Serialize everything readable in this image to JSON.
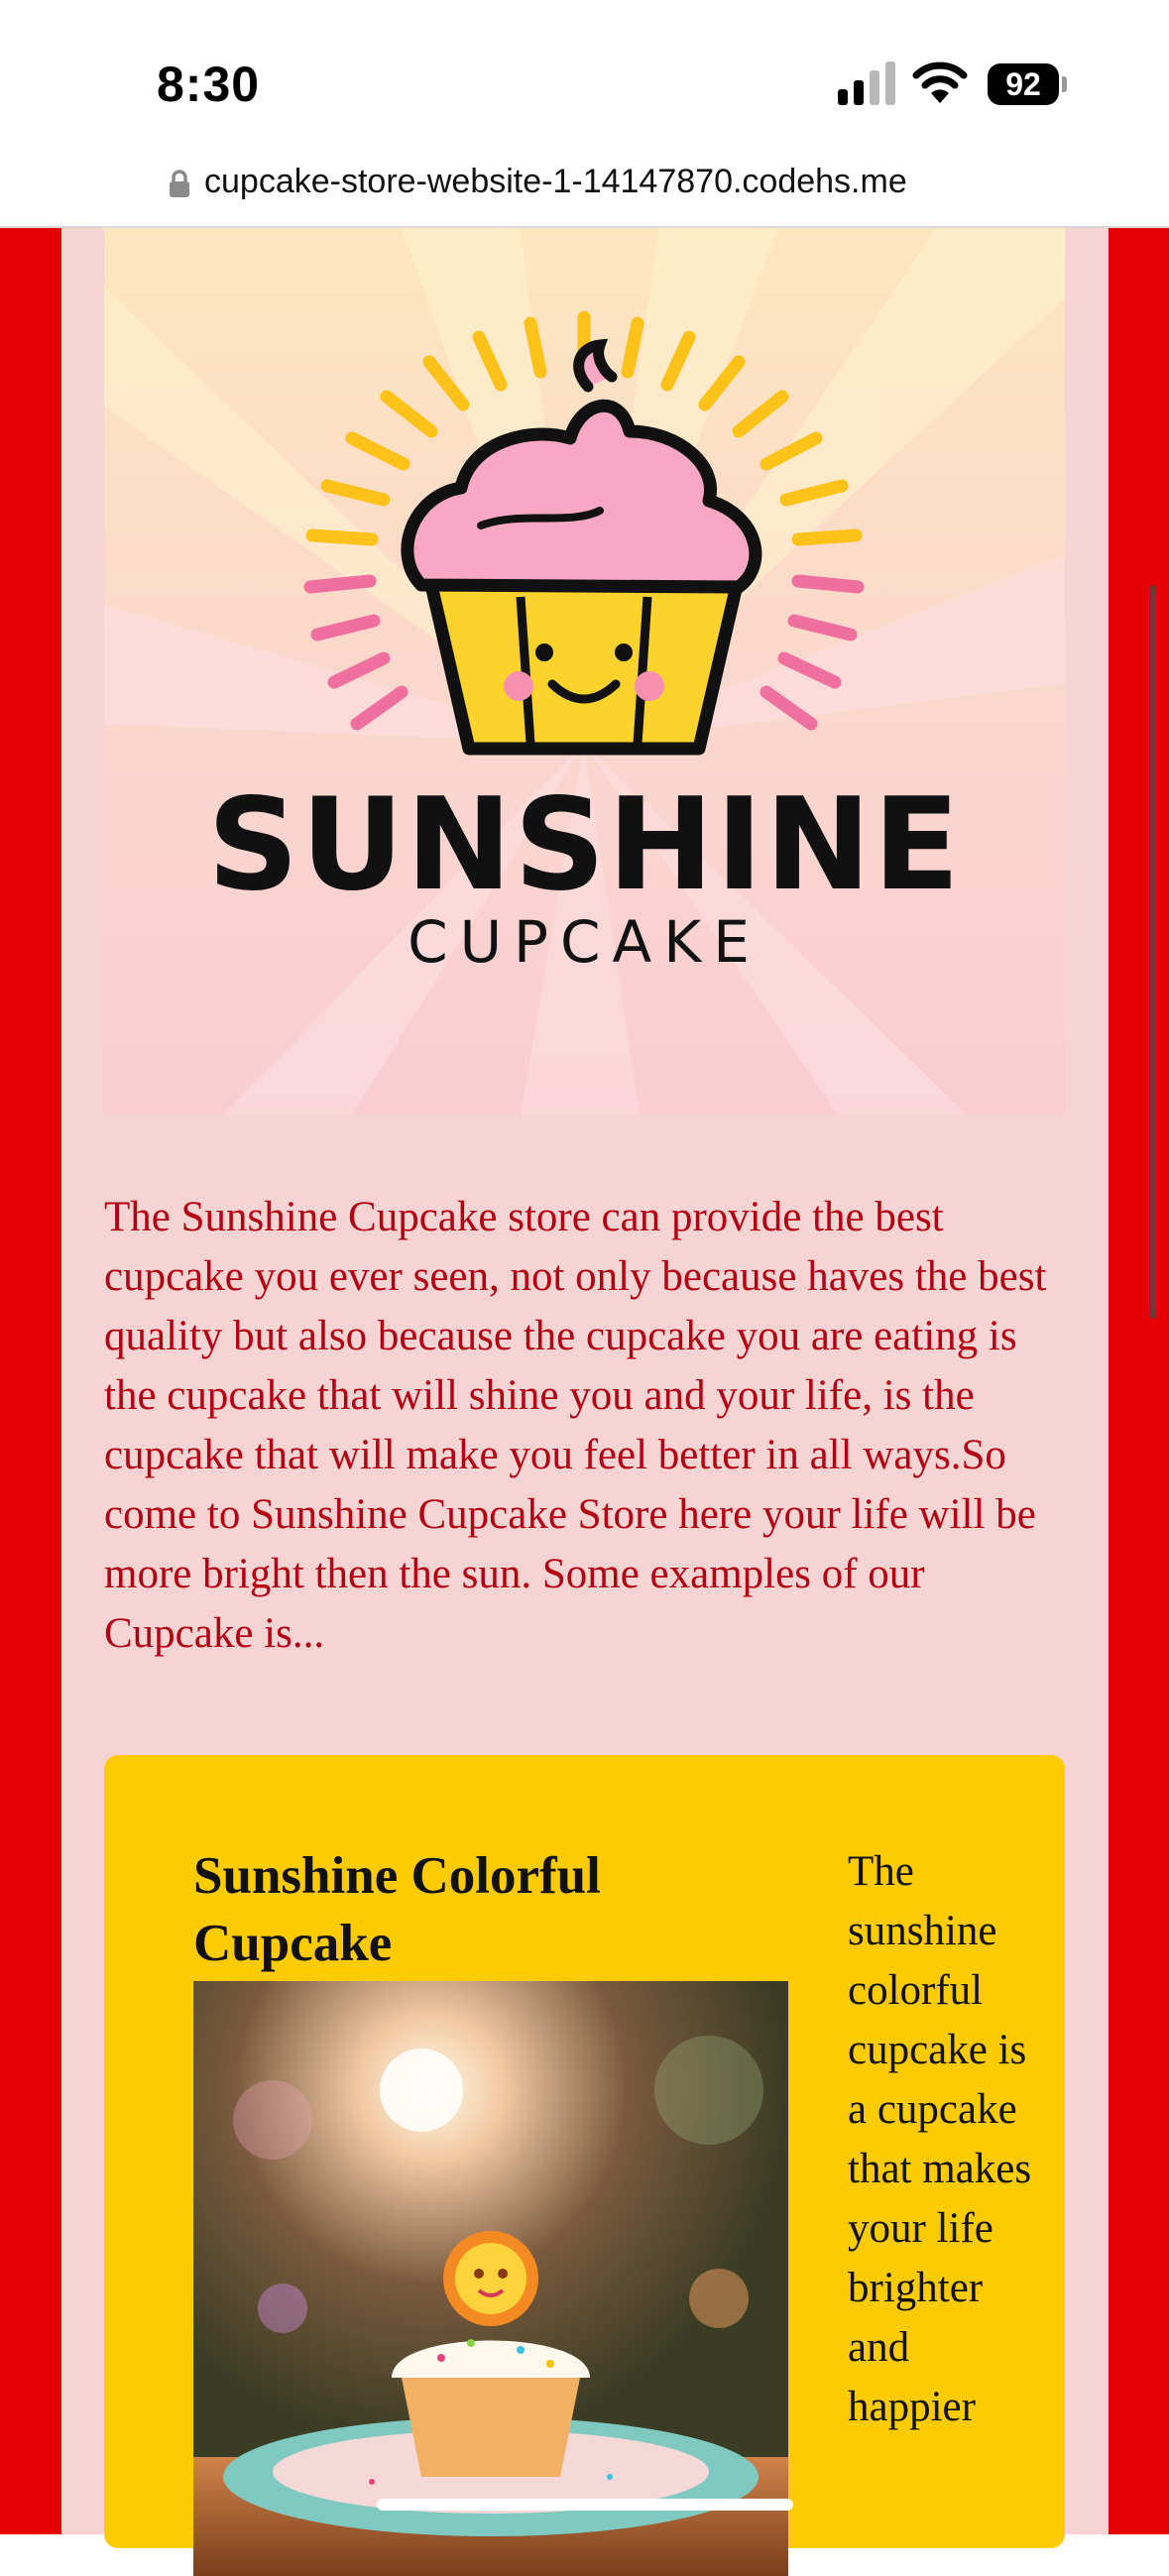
{
  "status_bar": {
    "time": "8:30",
    "battery_level": "92",
    "icons": [
      "signal-icon",
      "wifi-icon",
      "battery-icon"
    ]
  },
  "browser": {
    "url": "cupcake-store-website-1-14147870.codehs.me",
    "icons": [
      "lock-icon"
    ]
  },
  "hero": {
    "brand_name": "SUNSHINE",
    "brand_sub": "CUPCAKE"
  },
  "intro": {
    "text": "The Sunshine Cupcake store can provide the best cupcake you ever seen, not only because haves the best quality but also because the cupcake you are eating is the cupcake that will shine you and your life, is the cupcake that will make you feel better in all ways.So come to Sunshine Cupcake Store here your life will be more bright then the sun. Some examples of our Cupcake is..."
  },
  "product": {
    "title": "Sunshine Colorful Cupcake",
    "description": "The sunshine colorful cupcake is a cupcake that makes your life brighter and happier"
  },
  "colors": {
    "page_red": "#e60005",
    "panel_pink": "#f7d4d4",
    "card_yellow": "#fdcb02",
    "intro_text": "#b30012"
  }
}
